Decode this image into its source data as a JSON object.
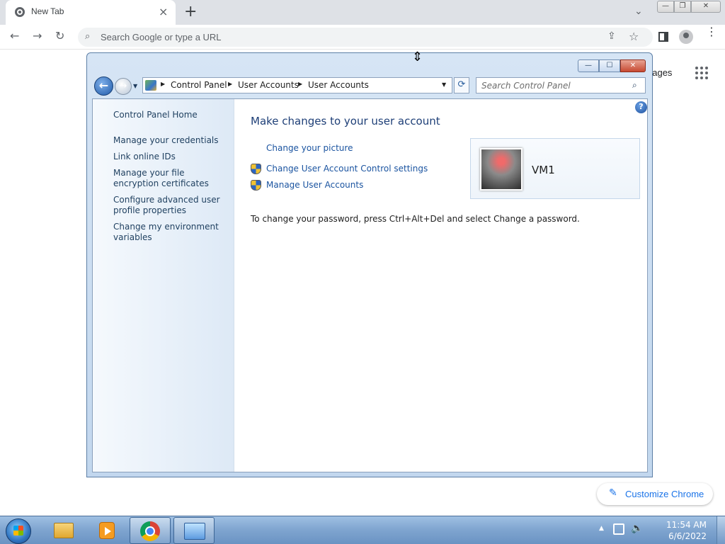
{
  "chrome": {
    "tab_title": "New Tab",
    "tab_close": "×",
    "new_tab": "+",
    "tab_search": "⌄",
    "window_min": "—",
    "window_max": "❐",
    "window_close": "✕",
    "back": "←",
    "forward": "→",
    "reload": "↻",
    "omnibox_placeholder": "Search Google or type a URL",
    "share": "⇪",
    "star": "☆",
    "menu": "⋮",
    "images_link": "nages",
    "customize_label": "Customize Chrome",
    "customize_icon": "✎"
  },
  "control_panel": {
    "title_min": "—",
    "title_max": "☐",
    "title_close": "✕",
    "back": "←",
    "forward": "→",
    "history": "▼",
    "breadcrumbs": [
      "Control Panel",
      "User Accounts",
      "User Accounts"
    ],
    "crumb_sep": "▶",
    "address_dropdown": "▼",
    "refresh": "⟳",
    "search_placeholder": "Search Control Panel",
    "search_icon": "⌕",
    "help": "?",
    "nav": {
      "home": "Control Panel Home",
      "links": [
        "Manage your credentials",
        "Link online IDs",
        "Manage your file encryption certificates",
        "Configure advanced user profile properties",
        "Change my environment variables"
      ]
    },
    "heading": "Make changes to your user account",
    "tasks": [
      "Change your picture",
      "Change User Account Control settings",
      "Manage User Accounts"
    ],
    "note": "To change your password, press Ctrl+Alt+Del and select Change a password.",
    "user_name": "VM1"
  },
  "taskbar": {
    "tray_arrow": "▲",
    "volume": "🔈",
    "time": "11:54 AM",
    "date": "6/6/2022"
  },
  "cursor": "⇕",
  "colors": {
    "link": "#1b54a0",
    "chrome_accent": "#1a73e8",
    "taskbar": "#7ea4cf"
  }
}
